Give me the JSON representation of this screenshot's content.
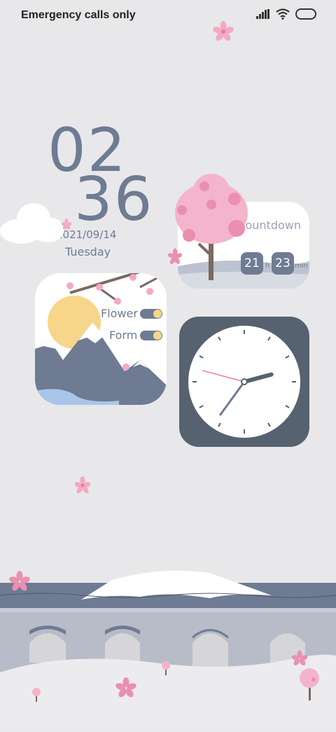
{
  "status_bar": {
    "carrier_text": "Emergency calls only",
    "icons": [
      "signal-icon",
      "wifi-icon",
      "battery-icon"
    ]
  },
  "clock": {
    "hour": "02",
    "minute": "36",
    "date": "2021/09/14",
    "weekday": "Tuesday"
  },
  "countdown_widget": {
    "label": "countdown",
    "hours": "21",
    "hours_unit": "h",
    "minutes": "23",
    "minutes_unit": "min"
  },
  "flower_widget": {
    "items": [
      {
        "label": "Flower",
        "toggle_on": true
      },
      {
        "label": "Form",
        "toggle_on": true
      }
    ]
  },
  "analog_clock": {
    "hour_hand_deg": 75,
    "minute_hand_deg": 216,
    "second_hand_deg": 285
  },
  "colors": {
    "background": "#e8e8ea",
    "accent_slate": "#6e7b93",
    "blossom_pink": "#f4a9c4",
    "sun_yellow": "#f7d58a",
    "clock_frame": "#566270"
  }
}
